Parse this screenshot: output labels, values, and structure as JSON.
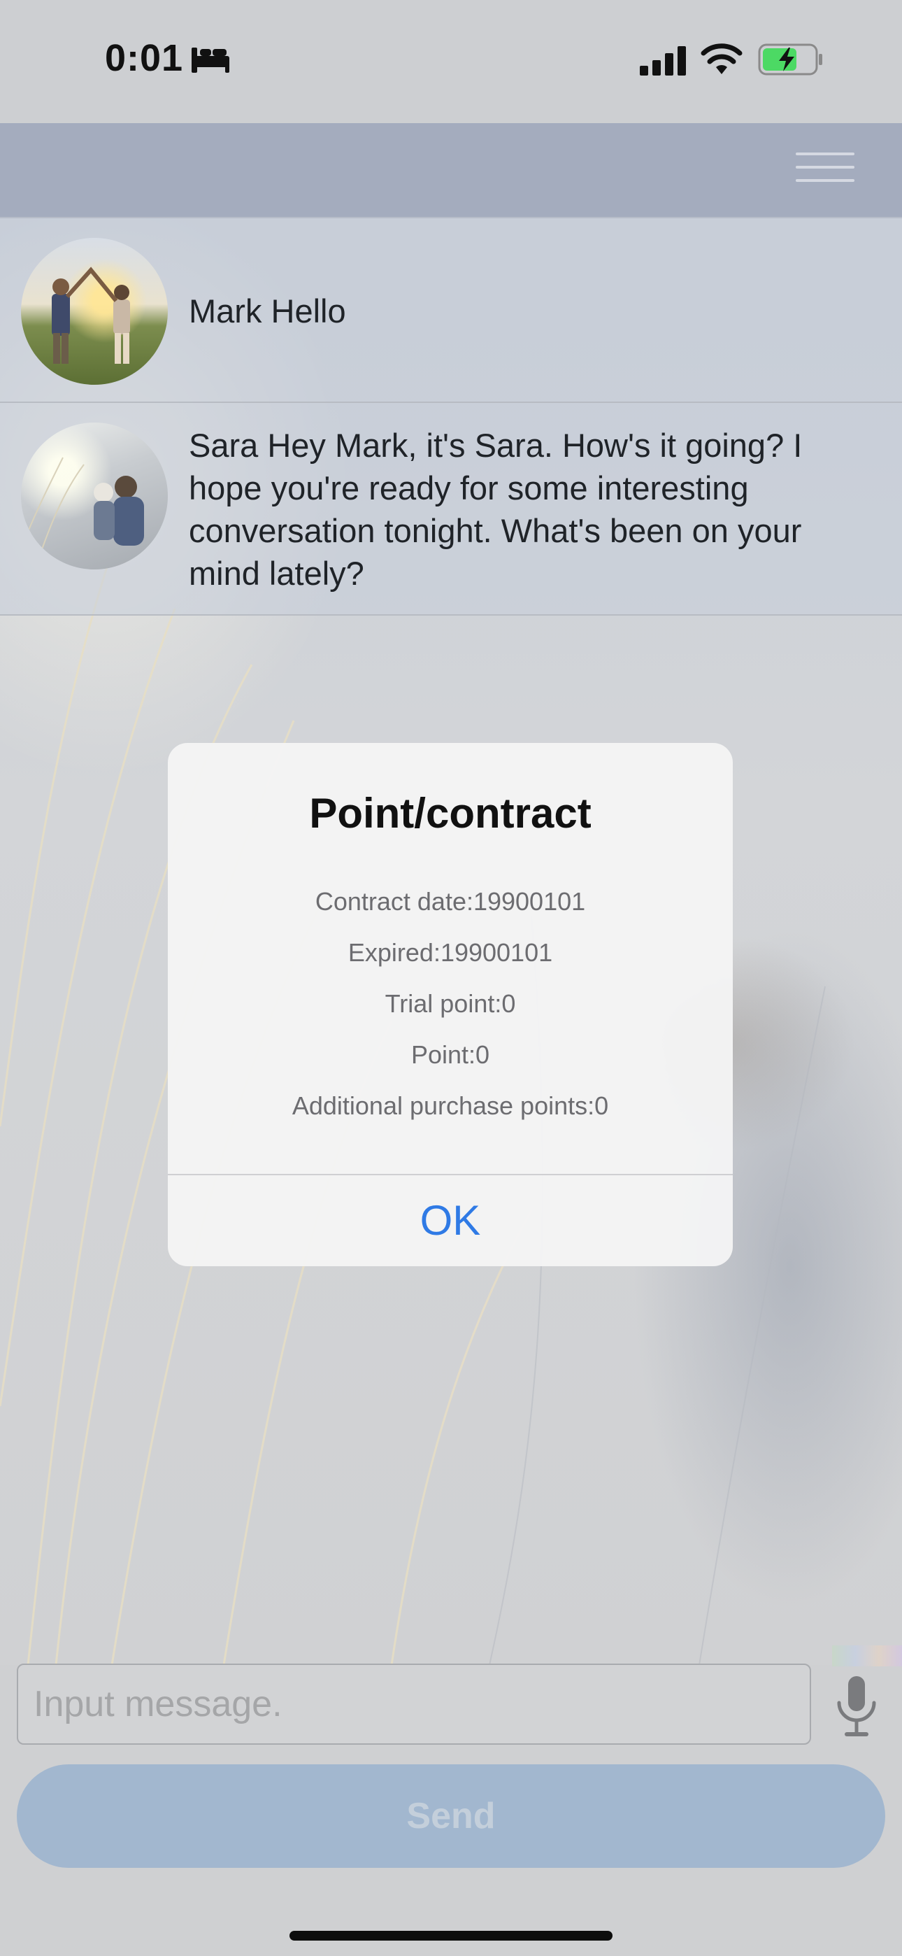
{
  "status_bar": {
    "time": "0:01"
  },
  "nav": {},
  "messages": [
    {
      "text": "Mark Hello"
    },
    {
      "text": "Sara Hey Mark, it's Sara. How's it going? I hope you're ready for some interesting conversation tonight. What's been on your mind lately?"
    }
  ],
  "dialog": {
    "title": "Point/contract",
    "lines": [
      "Contract date:19900101",
      "Expired:19900101",
      "Trial point:0",
      "Point:0",
      "Additional purchase points:0"
    ],
    "ok_label": "OK"
  },
  "composer": {
    "placeholder": "Input message.",
    "send_label": "Send"
  },
  "colors": {
    "accent": "#2f7ae5",
    "nav_bar": "#a4acbe",
    "send_button": "#a2b7cf"
  }
}
